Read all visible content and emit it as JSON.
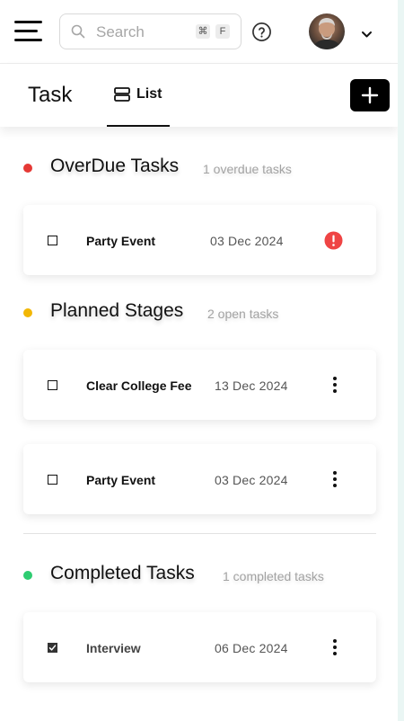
{
  "header": {
    "search": {
      "placeholder": "Search",
      "shortcut_keys": [
        "⌘",
        "F"
      ]
    },
    "icons": [
      "menu-icon",
      "search-icon",
      "help-icon",
      "chevron-down-icon"
    ]
  },
  "subheader": {
    "title": "Task",
    "active_tab": "List",
    "add_icon": "plus-icon"
  },
  "colors": {
    "overdue": "#e53935",
    "planned": "#f2b705",
    "completed": "#2ecc71",
    "alert": "#ef4444",
    "primary_button": "#000000"
  },
  "sections": {
    "overdue": {
      "title": "OverDue Tasks",
      "count": "1 overdue tasks",
      "tasks": [
        {
          "name": "Party Event",
          "date": "03 Dec 2024",
          "checked": false,
          "icon": "alert-icon"
        }
      ]
    },
    "planned": {
      "title": "Planned Stages",
      "count": "2 open tasks",
      "tasks": [
        {
          "name": "Clear College Fee",
          "date": "13 Dec 2024",
          "checked": false,
          "icon": "more-vertical-icon"
        },
        {
          "name": "Party Event",
          "date": "03 Dec 2024",
          "checked": false,
          "icon": "more-vertical-icon"
        }
      ]
    },
    "completed": {
      "title": "Completed Tasks",
      "count": "1 completed tasks",
      "tasks": [
        {
          "name": "Interview",
          "date": "06 Dec 2024",
          "checked": true,
          "icon": "more-vertical-icon"
        }
      ]
    }
  }
}
